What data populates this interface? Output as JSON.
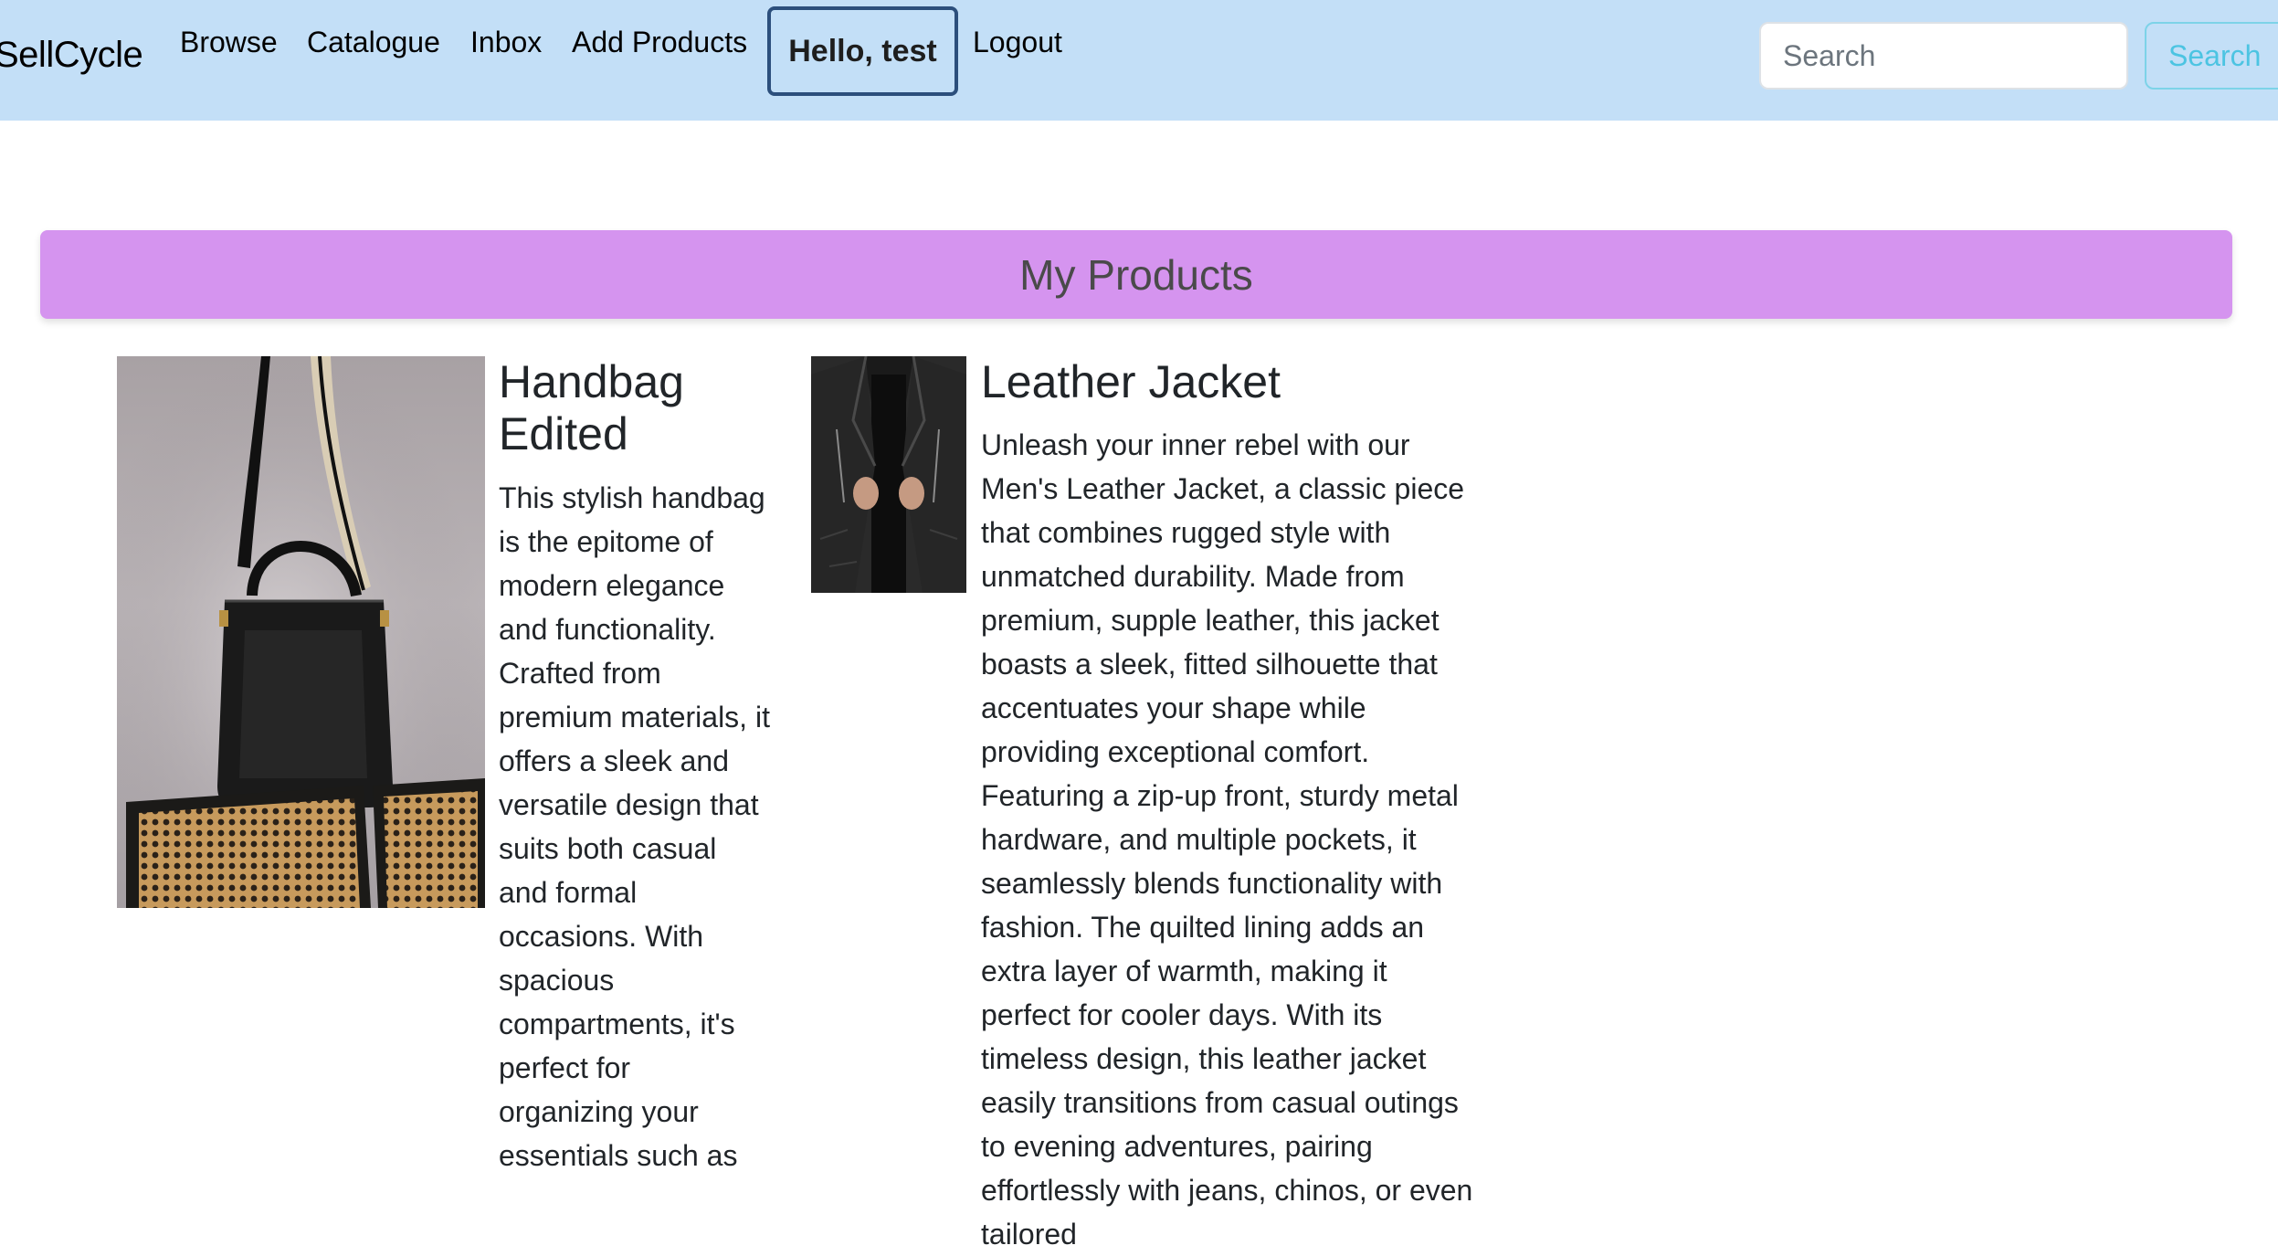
{
  "navbar": {
    "brand": "SellCycle",
    "links": [
      "Browse",
      "Catalogue",
      "Inbox",
      "Add Products"
    ],
    "user_greeting": "Hello, test",
    "logout": "Logout",
    "search_placeholder": "Search",
    "search_button": "Search",
    "background_color": "#c3dff7"
  },
  "banner": {
    "title": "My Products",
    "background_color": "#d594ef"
  },
  "products": [
    {
      "title": "Handbag Edited",
      "image_icon": "handbag-photo",
      "description": "This stylish handbag is the epitome of modern elegance and functionality. Crafted from premium materials, it offers a sleek and versatile design that suits both casual and formal occasions. With spacious compartments, it's perfect for organizing your essentials such as"
    },
    {
      "title": "Leather Jacket",
      "image_icon": "leather-jacket-photo",
      "description": "Unleash your inner rebel with our Men's Leather Jacket, a classic piece that combines rugged style with unmatched durability. Made from premium, supple leather, this jacket boasts a sleek, fitted silhouette that accentuates your shape while providing exceptional comfort. Featuring a zip-up front, sturdy metal hardware, and multiple pockets, it seamlessly blends functionality with fashion. The quilted lining adds an extra layer of warmth, making it perfect for cooler days. With its timeless design, this leather jacket easily transitions from casual outings to evening adventures, pairing effortlessly with jeans, chinos, or even tailored"
    }
  ]
}
